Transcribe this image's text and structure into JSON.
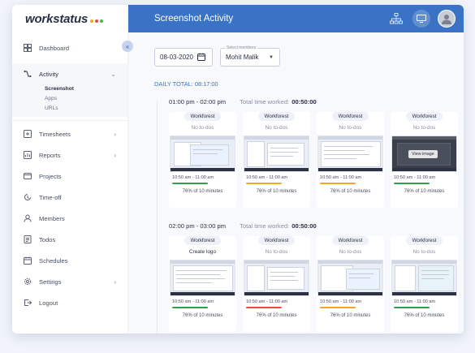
{
  "brand": {
    "logo_text": "workstatus",
    "dot_colors": [
      "#f5a623",
      "#e94e3c",
      "#4caf50"
    ]
  },
  "topbar": {
    "title": "Screenshot Activity",
    "icons": [
      "org-chart-icon",
      "screen-icon",
      "avatar"
    ]
  },
  "sidebar": {
    "collapse_glyph": "«",
    "items": [
      {
        "label": "Dashboard",
        "icon": "dashboard-icon"
      },
      {
        "label": "Activity",
        "icon": "activity-icon",
        "expanded": true,
        "sub": [
          {
            "label": "Screenshot",
            "current": true
          },
          {
            "label": "Apps"
          },
          {
            "label": "URLs"
          }
        ]
      },
      {
        "label": "Timesheets",
        "icon": "timesheet-icon",
        "chevron": true
      },
      {
        "label": "Reports",
        "icon": "reports-icon",
        "chevron": true
      },
      {
        "label": "Projects",
        "icon": "folder-icon"
      },
      {
        "label": "Time-off",
        "icon": "timeoff-icon"
      },
      {
        "label": "Members",
        "icon": "members-icon"
      },
      {
        "label": "Todos",
        "icon": "todos-icon"
      },
      {
        "label": "Schedules",
        "icon": "calendar-icon"
      },
      {
        "label": "Settings",
        "icon": "settings-icon",
        "chevron": true
      },
      {
        "label": "Logout",
        "icon": "logout-icon"
      }
    ]
  },
  "filters": {
    "date": "08-03-2020",
    "member_label": "Select members",
    "member_value": "Mohit Malik"
  },
  "daily_total": "DAILY TOTAL: 08:17:00",
  "slots": [
    {
      "range": "01:00 pm - 02:00 pm",
      "tw_label": "Total time worked:",
      "tw_value": "00:50:00",
      "cards": [
        {
          "project": "Workforest",
          "todo": "No to-dos",
          "time": "10:50 am - 11:00 am",
          "pct": "76% of 10 minutes",
          "bar": "#2e9e4f",
          "dark": false
        },
        {
          "project": "Workforest",
          "todo": "No to-dos",
          "time": "10:50 am - 11:00 am",
          "pct": "76% of 10 minutes",
          "bar": "#f5a623",
          "dark": false
        },
        {
          "project": "Workforest",
          "todo": "No to-dos",
          "time": "10:50 am - 11:00 am",
          "pct": "76% of 10 minutes",
          "bar": "#f5a623",
          "dark": false
        },
        {
          "project": "Workforest",
          "todo": "No to-dos",
          "time": "10:50 am - 11:00 am",
          "pct": "76% of 10 minutes",
          "bar": "#2e9e4f",
          "dark": true,
          "overlay": "View image"
        }
      ]
    },
    {
      "range": "02:00 pm - 03:00 pm",
      "tw_label": "Total time worked:",
      "tw_value": "00:50:00",
      "cards": [
        {
          "project": "Workforest",
          "todo": "Create logo",
          "time": "10:50 am - 11:00 am",
          "pct": "76% of 10 minutes",
          "bar": "#2e9e4f",
          "dark": false
        },
        {
          "project": "Workforest",
          "todo": "No to-dos",
          "time": "10:50 am - 11:00 am",
          "pct": "76% of 10 minutes",
          "bar": "#e94e3c",
          "dark": false
        },
        {
          "project": "Workforest",
          "todo": "No to-dos",
          "time": "10:50 am - 11:00 am",
          "pct": "76% of 10 minutes",
          "bar": "#f5a623",
          "dark": false
        },
        {
          "project": "Workforest",
          "todo": "No to-dos",
          "time": "10:50 am - 11:00 am",
          "pct": "76% of 10 minutes",
          "bar": "#2e9e4f",
          "dark": false
        }
      ]
    }
  ]
}
